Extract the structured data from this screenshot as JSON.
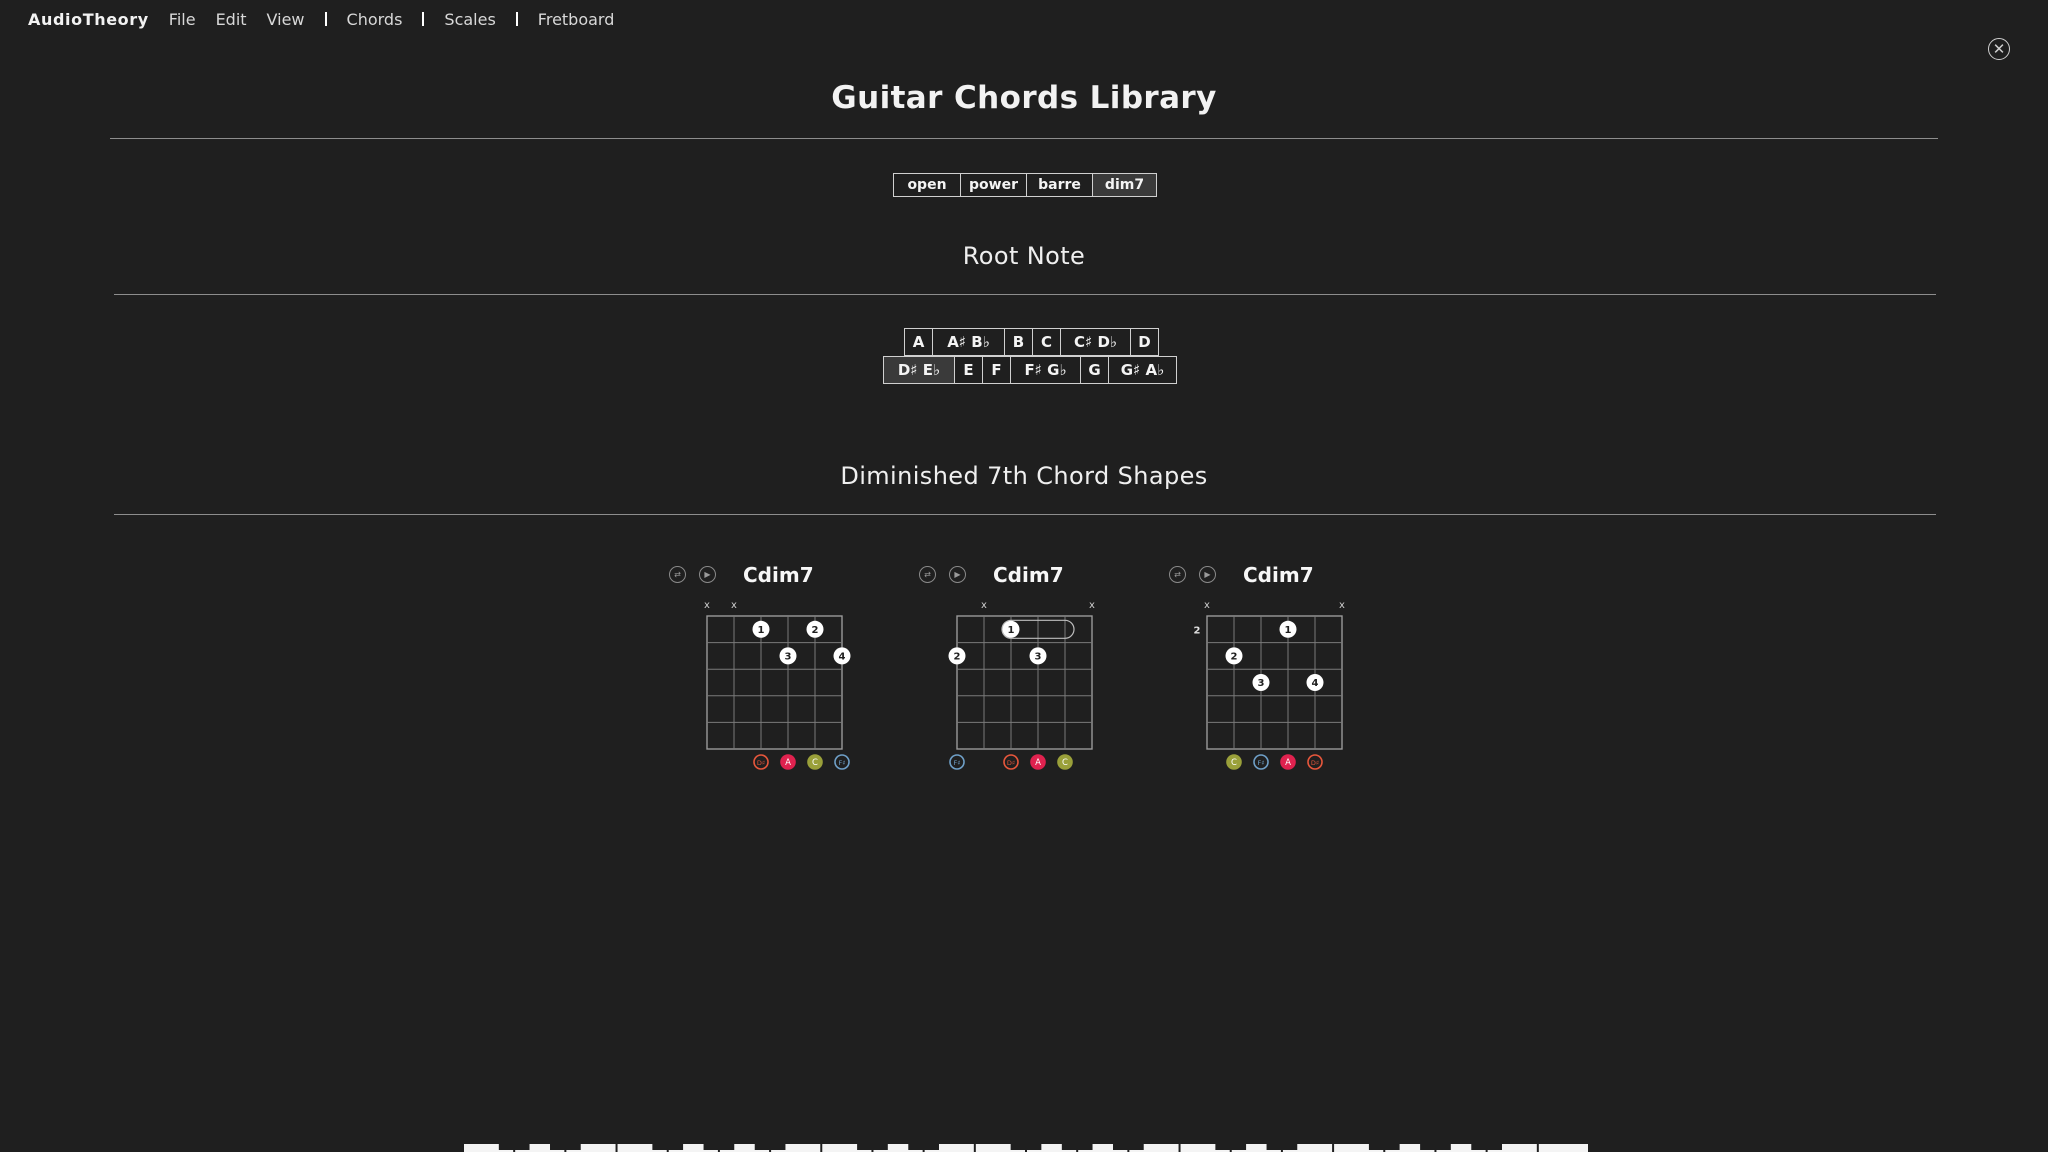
{
  "menubar": {
    "brand": "AudioTheory",
    "items": [
      "File",
      "Edit",
      "View"
    ],
    "nav": [
      "Chords",
      "Scales",
      "Fretboard"
    ]
  },
  "close_icon": "close-icon",
  "page": {
    "title": "Guitar Chords Library"
  },
  "chord_types": {
    "options": [
      "open",
      "power",
      "barre",
      "dim7"
    ],
    "selected": "dim7"
  },
  "root_note": {
    "heading": "Root Note",
    "row1": [
      "A",
      "A♯ B♭",
      "B",
      "C",
      "C♯ D♭",
      "D"
    ],
    "row2": [
      "D♯ E♭",
      "E",
      "F",
      "F♯ G♭",
      "G",
      "G♯ A♭"
    ],
    "selected": "D♯ E♭"
  },
  "shapes": {
    "heading": "Diminished 7th Chord Shapes",
    "controls": {
      "flip_icon": "flip-icon",
      "play_icon": "play-icon"
    },
    "chords": [
      {
        "name": "Cdim7",
        "start_fret": "",
        "string_marks": [
          "x",
          "x",
          "",
          "",
          "",
          ""
        ],
        "dots": [
          {
            "string": 3,
            "fret": 1,
            "finger": "1"
          },
          {
            "string": 5,
            "fret": 1,
            "finger": "2"
          },
          {
            "string": 4,
            "fret": 2,
            "finger": "3"
          },
          {
            "string": 6,
            "fret": 2,
            "finger": "4"
          }
        ],
        "barre": null,
        "notes": [
          "",
          "",
          "D♯",
          "A",
          "C",
          "F♯"
        ]
      },
      {
        "name": "Cdim7",
        "start_fret": "",
        "string_marks": [
          "",
          "x",
          "",
          "",
          "",
          "x"
        ],
        "dots": [
          {
            "string": 3,
            "fret": 1,
            "finger": "1"
          },
          {
            "string": 1,
            "fret": 2,
            "finger": "2"
          },
          {
            "string": 4,
            "fret": 2,
            "finger": "3"
          }
        ],
        "barre": {
          "fret": 1,
          "from": 3,
          "to": 5
        },
        "notes": [
          "F♯",
          "",
          "D♯",
          "A",
          "C",
          ""
        ]
      },
      {
        "name": "Cdim7",
        "start_fret": "2",
        "string_marks": [
          "x",
          "",
          "",
          "",
          "",
          "x"
        ],
        "dots": [
          {
            "string": 4,
            "fret": 1,
            "finger": "1"
          },
          {
            "string": 2,
            "fret": 2,
            "finger": "2"
          },
          {
            "string": 3,
            "fret": 3,
            "finger": "3"
          },
          {
            "string": 5,
            "fret": 3,
            "finger": "4"
          }
        ],
        "barre": null,
        "notes": [
          "",
          "C",
          "F♯",
          "A",
          "D♯",
          ""
        ]
      }
    ]
  },
  "note_colors": {
    "D♯": "#e8573c",
    "A": "#e0224f",
    "C": "#9aa03a",
    "F♯": "#6fa0c8"
  }
}
